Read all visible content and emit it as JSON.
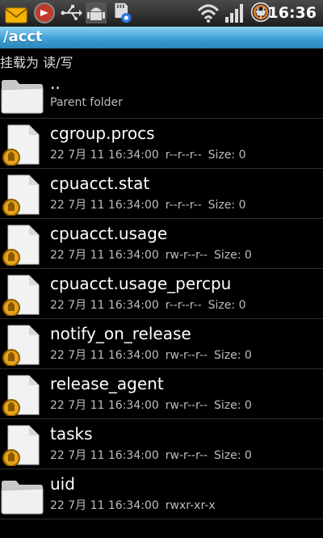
{
  "status_bar": {
    "time": "16:36",
    "icons": [
      "mail-icon",
      "browser-icon",
      "usb-icon",
      "android-debug-icon",
      "sd-card-icon",
      "wifi-icon",
      "signal-icon",
      "battery-charging-icon"
    ]
  },
  "path": "/acct",
  "mount_label": "挂载为 读/写",
  "items": [
    {
      "name": "..",
      "type": "folder",
      "subtitle": "Parent folder",
      "date": "",
      "perms": "",
      "size": ""
    },
    {
      "name": "cgroup.procs",
      "type": "file",
      "subtitle": "",
      "date": "22 7月 11 16:34:00",
      "perms": "r--r--r--",
      "size": "Size: 0"
    },
    {
      "name": "cpuacct.stat",
      "type": "file",
      "subtitle": "",
      "date": "22 7月 11 16:34:00",
      "perms": "r--r--r--",
      "size": "Size: 0"
    },
    {
      "name": "cpuacct.usage",
      "type": "file",
      "subtitle": "",
      "date": "22 7月 11 16:34:00",
      "perms": "rw-r--r--",
      "size": "Size: 0"
    },
    {
      "name": "cpuacct.usage_percpu",
      "type": "file",
      "subtitle": "",
      "date": "22 7月 11 16:34:00",
      "perms": "r--r--r--",
      "size": "Size: 0"
    },
    {
      "name": "notify_on_release",
      "type": "file",
      "subtitle": "",
      "date": "22 7月 11 16:34:00",
      "perms": "rw-r--r--",
      "size": "Size: 0"
    },
    {
      "name": "release_agent",
      "type": "file",
      "subtitle": "",
      "date": "22 7月 11 16:34:00",
      "perms": "rw-r--r--",
      "size": "Size: 0"
    },
    {
      "name": "tasks",
      "type": "file",
      "subtitle": "",
      "date": "22 7月 11 16:34:00",
      "perms": "rw-r--r--",
      "size": "Size: 0"
    },
    {
      "name": "uid",
      "type": "folder",
      "subtitle": "",
      "date": "22 7月 11 16:34:00",
      "perms": "rwxr-xr-x",
      "size": ""
    }
  ]
}
